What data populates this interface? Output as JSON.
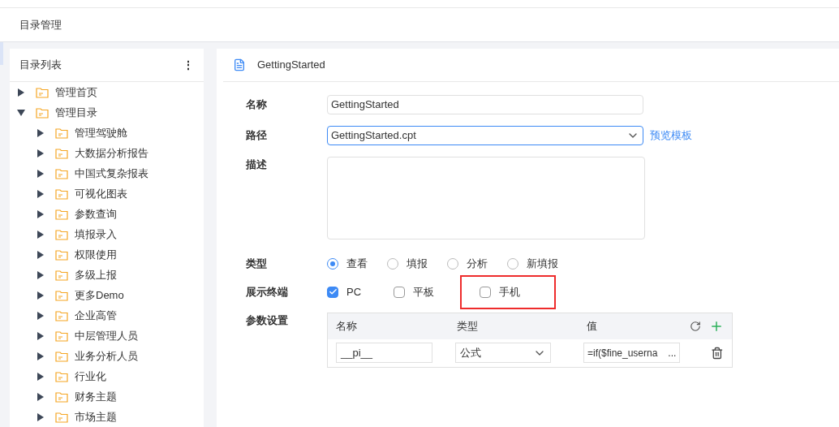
{
  "header": {
    "title": "目录管理"
  },
  "sidebar": {
    "title": "目录列表",
    "menu": "⋮",
    "tree": [
      {
        "label": "管理首页",
        "expanded": false
      },
      {
        "label": "管理目录",
        "expanded": true,
        "children": [
          {
            "label": "管理驾驶舱",
            "expanded": false
          },
          {
            "label": "大数据分析报告",
            "expanded": false
          },
          {
            "label": "中国式复杂报表",
            "expanded": false
          },
          {
            "label": "可视化图表",
            "expanded": false
          },
          {
            "label": "参数查询",
            "expanded": false
          },
          {
            "label": "填报录入",
            "expanded": false
          },
          {
            "label": "权限使用",
            "expanded": false
          },
          {
            "label": "多级上报",
            "expanded": false
          },
          {
            "label": "更多Demo",
            "expanded": false
          },
          {
            "label": "企业高管",
            "expanded": false
          },
          {
            "label": "中层管理人员",
            "expanded": false
          },
          {
            "label": "业务分析人员",
            "expanded": false
          },
          {
            "label": "行业化",
            "expanded": false
          },
          {
            "label": "财务主题",
            "expanded": false
          },
          {
            "label": "市场主题",
            "expanded": false
          }
        ]
      }
    ]
  },
  "detail": {
    "title": "GettingStarted",
    "name": {
      "label": "名称",
      "value": "GettingStarted"
    },
    "path": {
      "label": "路径",
      "value": "GettingStarted.cpt",
      "link": "预览模板"
    },
    "description": {
      "label": "描述"
    },
    "type": {
      "label": "类型",
      "options": [
        {
          "label": "查看",
          "selected": true
        },
        {
          "label": "填报",
          "selected": false
        },
        {
          "label": "分析",
          "selected": false
        },
        {
          "label": "新填报",
          "selected": false
        }
      ]
    },
    "terminals": {
      "label": "展示终端",
      "options": [
        {
          "label": "PC",
          "checked": true,
          "highlighted": false
        },
        {
          "label": "平板",
          "checked": false,
          "highlighted": false
        },
        {
          "label": "手机",
          "checked": false,
          "highlighted": true
        }
      ]
    },
    "params": {
      "label": "参数设置",
      "columns": [
        "名称",
        "类型",
        "值"
      ],
      "rows": [
        {
          "name": "__pi__",
          "type": "公式",
          "value": "=if($fine_userna",
          "more": "..."
        }
      ]
    }
  }
}
